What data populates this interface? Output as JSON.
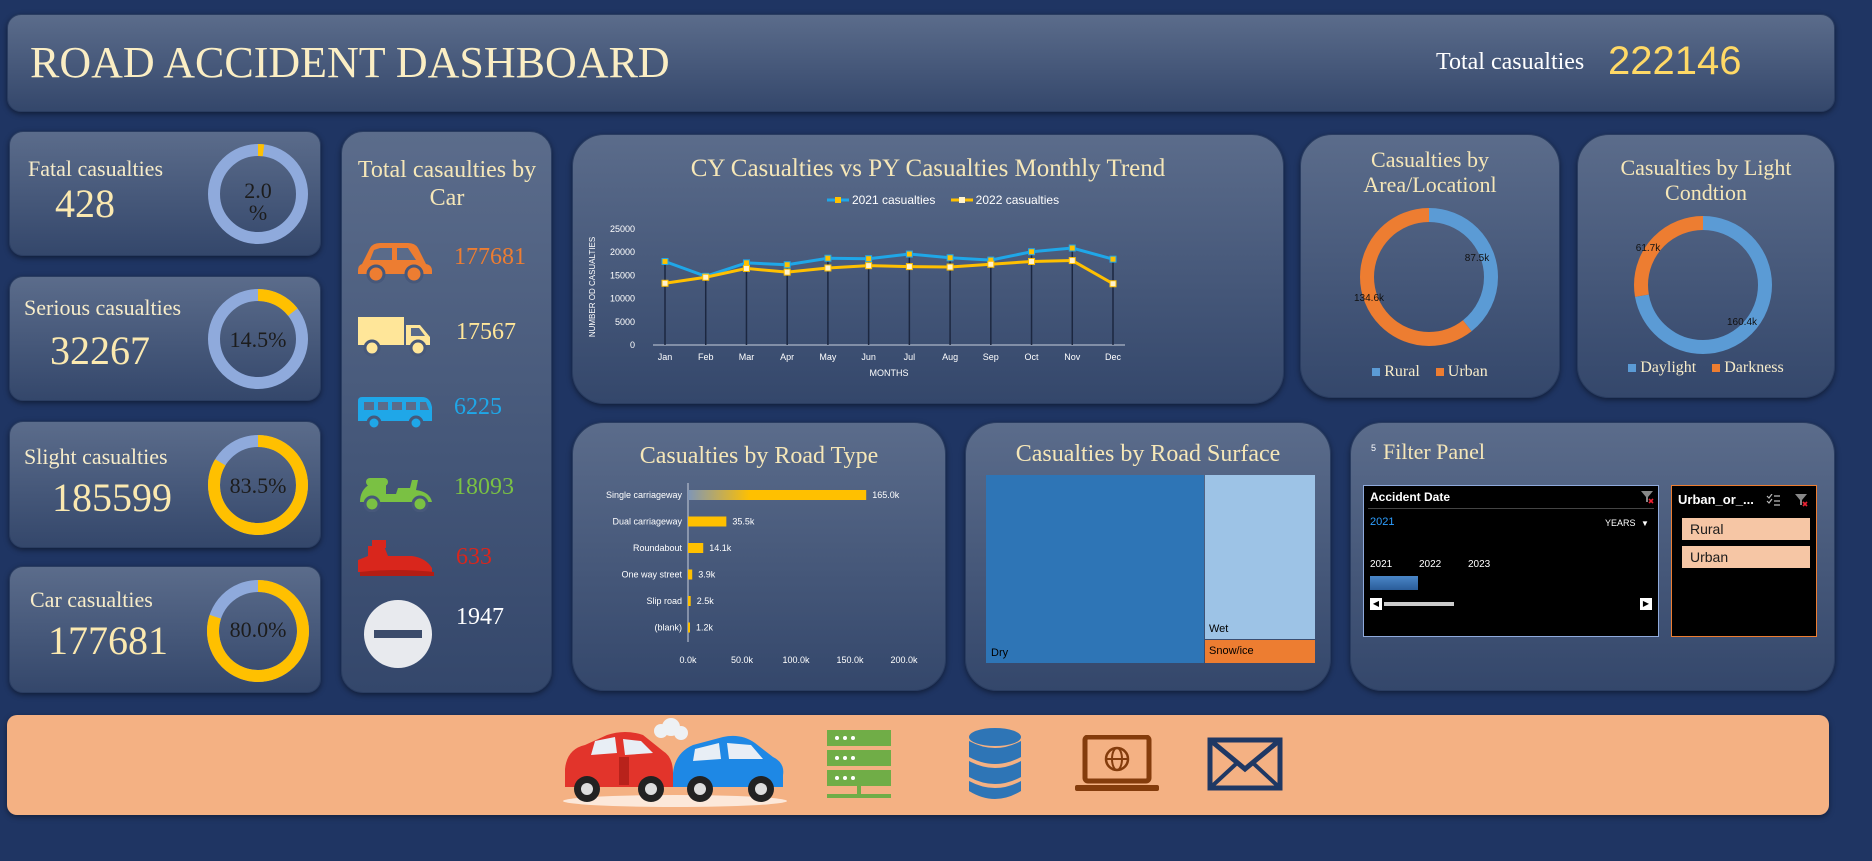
{
  "header": {
    "title": "ROAD ACCIDENT DASHBOARD",
    "total_label": "Total casualties",
    "total_value": "222146"
  },
  "kpis": [
    {
      "label": "Fatal casualties",
      "value": "428",
      "pct_text": "2.0\n%",
      "pct": 2.0
    },
    {
      "label": "Serious casualties",
      "value": "32267",
      "pct_text": "14.5%",
      "pct": 14.5
    },
    {
      "label": "Slight casualties",
      "value": "185599",
      "pct_text": "83.5%",
      "pct": 83.5
    },
    {
      "label": "Car casualties",
      "value": "177681",
      "pct_text": "80.0%",
      "pct": 80.0
    }
  ],
  "vehicles": {
    "title": "Total casaulties by Car",
    "items": [
      {
        "icon": "car-icon",
        "value": "177681",
        "color": "#ed7d31"
      },
      {
        "icon": "truck-icon",
        "value": "17567",
        "color": "#ffe699"
      },
      {
        "icon": "bus-icon",
        "value": "6225",
        "color": "#1fa7e8"
      },
      {
        "icon": "scooter-icon",
        "value": "18093",
        "color": "#7ac143"
      },
      {
        "icon": "tractor-icon",
        "value": "633",
        "color": "#d9261c"
      },
      {
        "icon": "minus-circle-icon",
        "value": "1947",
        "color": "#ffffff"
      }
    ]
  },
  "colors": {
    "accent_yellow": "#ffc000",
    "ring_blue": "#8faadc",
    "orange": "#ed7d31",
    "blue": "#5b9bd5",
    "footer": "#f4b183"
  },
  "chart_data": [
    {
      "type": "line",
      "title": "CY Casualties vs PY Casualties Monthly Trend",
      "xlabel": "MONTHS",
      "ylabel": "NUMBER OD CASUALTIES",
      "ylim": [
        0,
        25000
      ],
      "y_ticks": [
        "25000",
        "20000",
        "15000",
        "10000",
        "5000",
        "0"
      ],
      "categories": [
        "Jan",
        "Feb",
        "Mar",
        "Apr",
        "May",
        "Jun",
        "Jul",
        "Aug",
        "Sep",
        "Oct",
        "Nov",
        "Dec"
      ],
      "series": [
        {
          "name": "2021 casualties",
          "color": "#1fa7e8",
          "values": [
            18000,
            14800,
            17700,
            17300,
            18700,
            18600,
            19600,
            18800,
            18300,
            20100,
            20900,
            18500
          ]
        },
        {
          "name": "2022 casualties",
          "color": "#ffc000",
          "values": [
            13300,
            14600,
            16500,
            15700,
            16600,
            17100,
            16900,
            16800,
            17400,
            18000,
            18200,
            13200
          ]
        }
      ],
      "grid": false,
      "legend": "top"
    },
    {
      "type": "pie",
      "title": "Casualties by Area/Locationl",
      "categories": [
        "Rural",
        "Urban"
      ],
      "values": [
        87.5,
        134.6
      ],
      "labels": [
        "87.5k",
        "134.6k"
      ],
      "colors": [
        "#5b9bd5",
        "#ed7d31"
      ],
      "legend": "bottom"
    },
    {
      "type": "pie",
      "title": "Casualties by Light Condtion",
      "categories": [
        "Daylight",
        "Darkness"
      ],
      "values": [
        160.4,
        61.7
      ],
      "labels": [
        "160.4k",
        "61.7k"
      ],
      "colors": [
        "#5b9bd5",
        "#ed7d31"
      ],
      "legend": "bottom"
    },
    {
      "type": "bar",
      "title": "Casualties by Road Type",
      "categories": [
        "Single carriageway",
        "Dual carriageway",
        "Roundabout",
        "One way street",
        "Slip road",
        "(blank)"
      ],
      "values": [
        165.0,
        35.5,
        14.1,
        3.9,
        2.5,
        1.2
      ],
      "labels": [
        "165.0k",
        "35.5k",
        "14.1k",
        "3.9k",
        "2.5k",
        "1.2k"
      ],
      "x_ticks": [
        "0.0k",
        "50.0k",
        "100.0k",
        "150.0k",
        "200.0k"
      ],
      "xlim": [
        0,
        200
      ]
    },
    {
      "type": "treemap",
      "title": "Casualties by Road Surface",
      "categories": [
        "Dry",
        "Wet",
        "Snow/ice"
      ],
      "colors": [
        "#2e75b6",
        "#9dc3e6",
        "#ed7d31"
      ]
    }
  ],
  "filter": {
    "badge": "5",
    "title": "Filter Panel",
    "date_slicer": {
      "title": "Accident Date",
      "selected": "2021",
      "unit": "YEARS",
      "years": [
        "2021",
        "2022",
        "2023"
      ]
    },
    "area_slicer": {
      "title": "Urban_or_...",
      "items": [
        "Rural",
        "Urban"
      ]
    }
  },
  "footer": {
    "icons": [
      "crash-cars-icon",
      "server-icon",
      "database-icon",
      "laptop-globe-icon",
      "envelope-icon"
    ]
  }
}
